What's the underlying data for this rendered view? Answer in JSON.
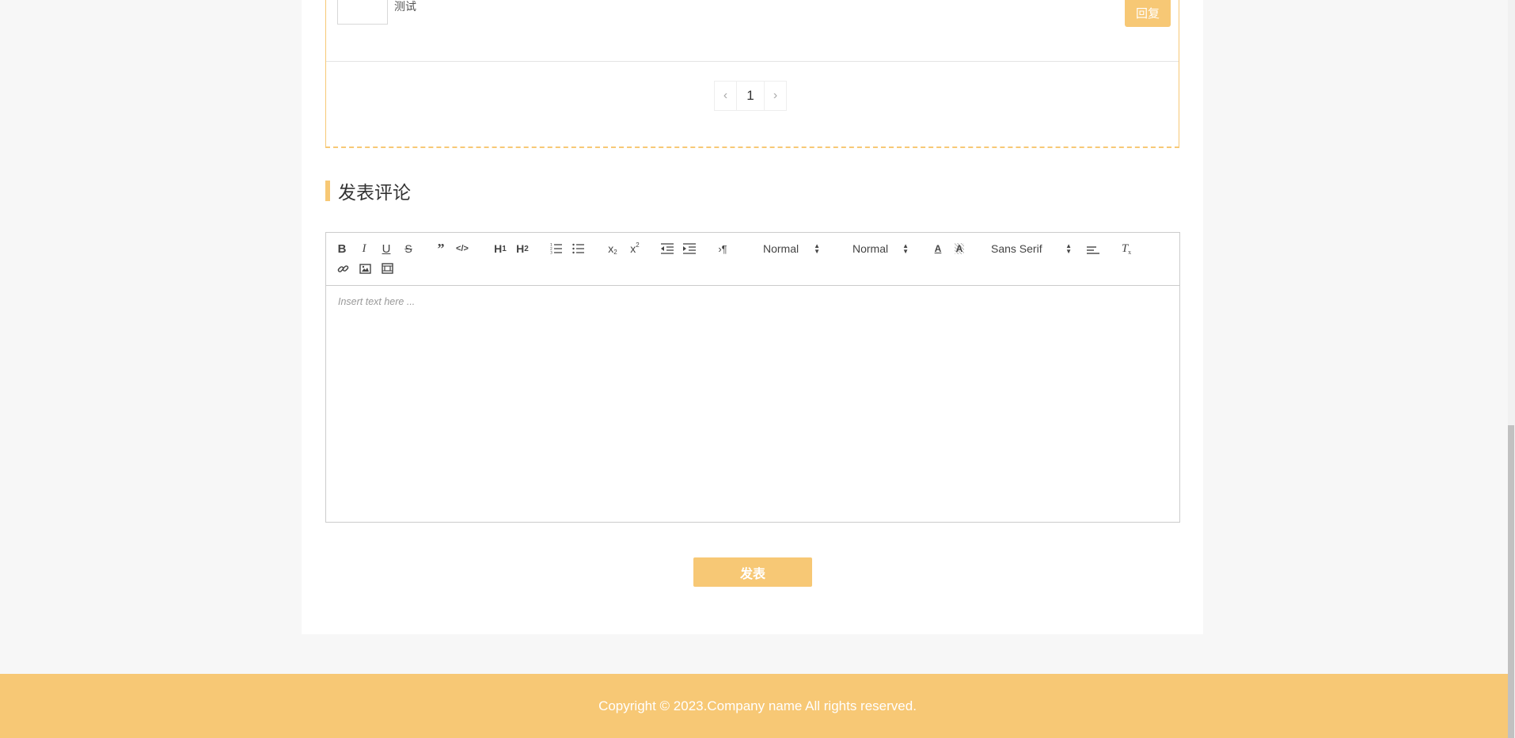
{
  "comment": {
    "text": "测试",
    "reply_label": "回复"
  },
  "pagination": {
    "prev": "‹",
    "current": "1",
    "next": "›"
  },
  "section": {
    "title": "发表评论"
  },
  "editor": {
    "toolbar": {
      "header_picker": "Normal",
      "size_picker": "Normal",
      "font_picker": "Sans Serif",
      "buttons": [
        "bold-icon",
        "italic-icon",
        "underline-icon",
        "strike-icon",
        "blockquote-icon",
        "code-block-icon",
        "h1-icon",
        "h2-icon",
        "ordered-list-icon",
        "bullet-list-icon",
        "subscript-icon",
        "superscript-icon",
        "outdent-icon",
        "indent-icon",
        "rtl-icon",
        "text-color-icon",
        "background-color-icon",
        "align-icon",
        "clean-format-icon",
        "link-icon",
        "image-icon",
        "video-icon"
      ]
    },
    "placeholder": "Insert text here ..."
  },
  "submit": {
    "label": "发表"
  },
  "footer": {
    "copyright": "Copyright © 2023.Company name All rights reserved."
  },
  "colors": {
    "accent": "#f7c875",
    "page_bg": "#f7f7f7",
    "panel_bg": "#ffffff"
  }
}
